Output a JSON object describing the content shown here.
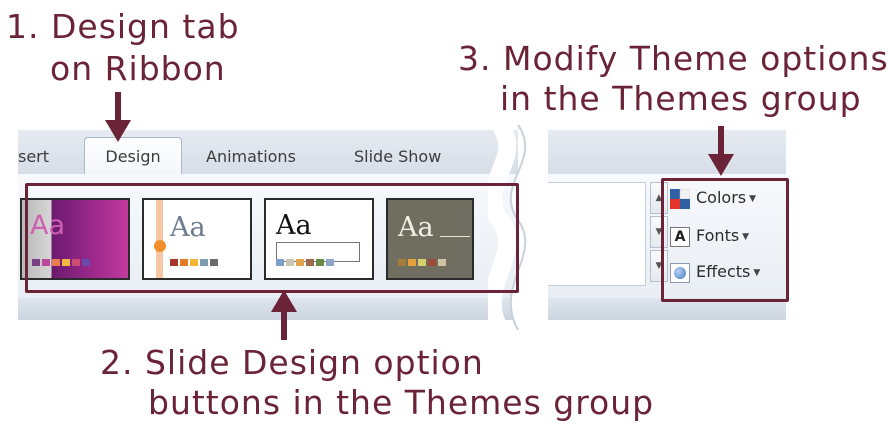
{
  "callouts": {
    "design_tab_line1": "1. Design tab",
    "design_tab_line2": "on Ribbon",
    "theme_options_line1": "3. Modify Theme options",
    "theme_options_line2": "in the Themes group",
    "slide_design_line1": "2. Slide Design option",
    "slide_design_line2": "buttons in the Themes group"
  },
  "ribbon": {
    "tabs": [
      "sert",
      "Design",
      "Animations",
      "Slide Show"
    ],
    "active_tab": "Design"
  },
  "themes": {
    "thumb_label": "Aa",
    "thumb_count": 4,
    "scroll_icons": [
      "up-arrow-icon",
      "down-arrow-icon",
      "more-icon"
    ]
  },
  "theme_options": {
    "colors": "Colors",
    "fonts": "Fonts",
    "effects": "Effects",
    "fonts_icon_letter": "A"
  },
  "colors": {
    "annotation": "#6b2337",
    "ribbon_bg": "#e9eef4"
  }
}
